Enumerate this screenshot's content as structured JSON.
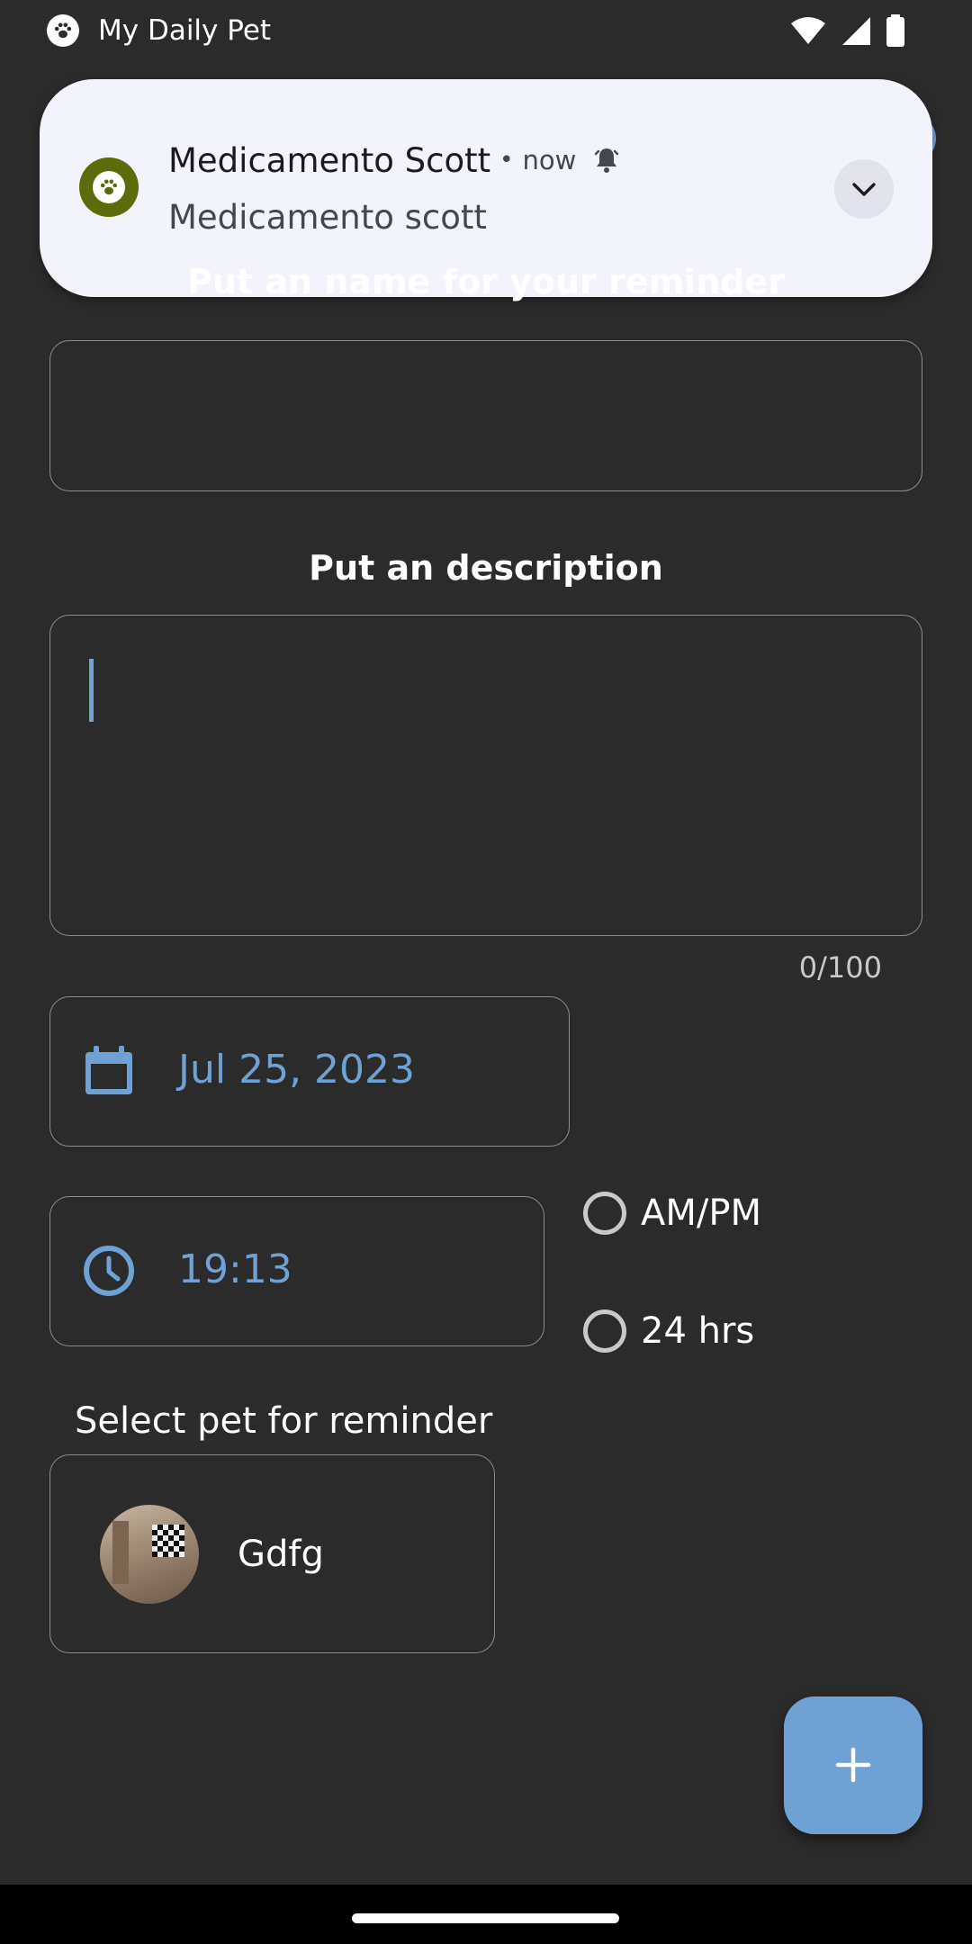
{
  "status_bar": {
    "app_name": "My Daily Pet",
    "icons": [
      "wifi-icon",
      "signal-icon",
      "battery-icon"
    ]
  },
  "notification": {
    "title": "Medicamento Scott",
    "separator": "•",
    "time": "now",
    "body": "Medicamento scott",
    "icons": [
      "paw-icon",
      "bell-icon",
      "chevron-down-icon"
    ]
  },
  "form": {
    "name_label": "Put an name for your reminder",
    "name_value": "",
    "description_label": "Put an description",
    "description_value": "",
    "char_counter": "0/100",
    "date_value": "Jul 25, 2023",
    "time_value": "19:13",
    "time_format_options": [
      {
        "label": "AM/PM",
        "selected": false
      },
      {
        "label": "24 hrs",
        "selected": false
      }
    ],
    "pet_select_label": "Select pet for reminder",
    "pets": [
      {
        "name": "Gdfg"
      }
    ]
  },
  "colors": {
    "background": "#2b2b2b",
    "accent": "#6fa1d4",
    "notification_bg": "#f2f3fb",
    "avatar_olive": "#5d6b0a"
  }
}
